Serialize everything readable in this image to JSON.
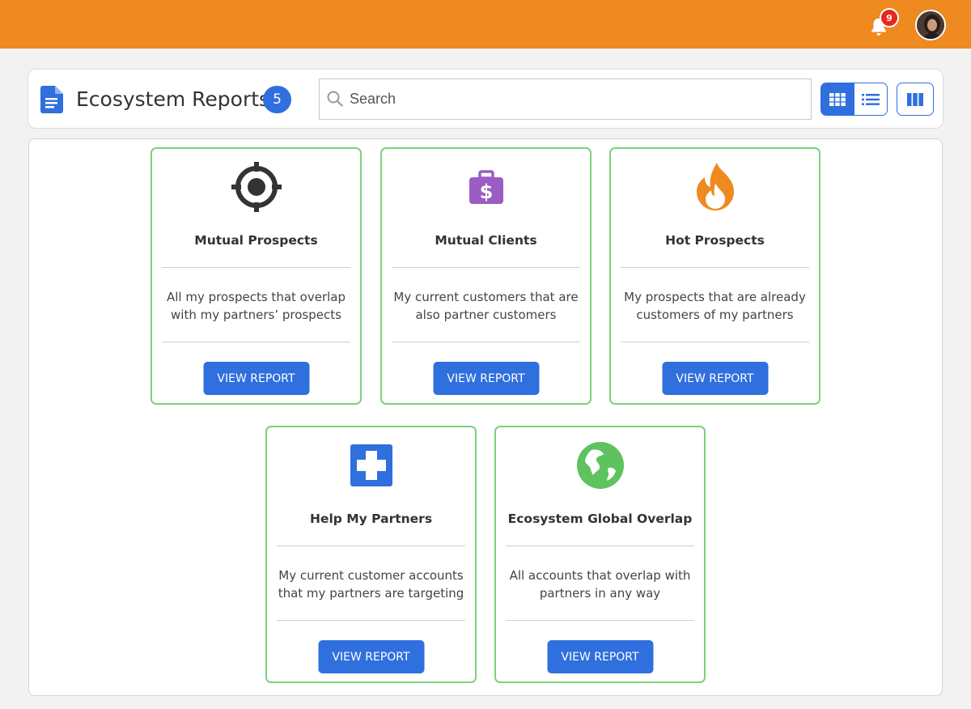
{
  "topbar": {
    "notification_count": "9"
  },
  "header": {
    "title": "Ecosystem Reports",
    "count": "5",
    "search": {
      "placeholder": "Search",
      "value": ""
    }
  },
  "colors": {
    "topbar": "#ee8a1f",
    "accent": "#2f6fde",
    "card_border": "#7dd17b"
  },
  "reports": [
    {
      "icon": "target-icon",
      "title": "Mutual Prospects",
      "description": "All my prospects that overlap with my partners’ prospects",
      "button": "VIEW REPORT"
    },
    {
      "icon": "money-bag-icon",
      "title": "Mutual Clients",
      "description": "My current customers that are also partner customers",
      "button": "VIEW REPORT"
    },
    {
      "icon": "flame-icon",
      "title": "Hot Prospects",
      "description": "My prospects that are already customers of my partners",
      "button": "VIEW REPORT"
    },
    {
      "icon": "plus-icon",
      "title": "Help My Partners",
      "description": "My current customer accounts that my partners are targeting",
      "button": "VIEW REPORT"
    },
    {
      "icon": "globe-icon",
      "title": "Ecosystem Global Overlap",
      "description": "All accounts that overlap with partners in any way",
      "button": "VIEW REPORT"
    }
  ]
}
